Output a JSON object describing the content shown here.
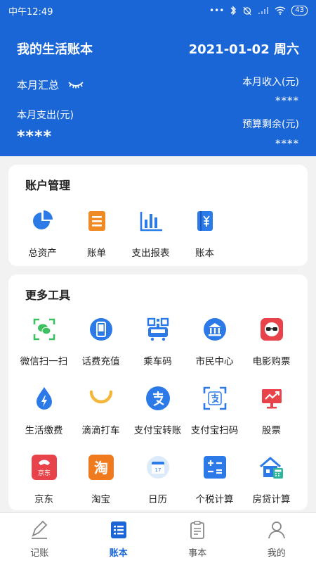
{
  "status_bar": {
    "time": "中午12:49",
    "dots": "•••",
    "battery": "43"
  },
  "header": {
    "title": "我的生活账本",
    "date": "2021-01-02 周六",
    "summary_label": "本月汇总",
    "spend_label": "本月支出(元)",
    "spend_value": "****",
    "income_label": "本月收入(元)",
    "income_value": "****",
    "budget_label": "预算剩余(元)",
    "budget_value": "****"
  },
  "accounts": {
    "title": "账户管理",
    "items": [
      {
        "label": "总资产",
        "icon": "pie-chart-icon"
      },
      {
        "label": "账单",
        "icon": "bill-list-icon"
      },
      {
        "label": "支出报表",
        "icon": "bar-chart-icon"
      },
      {
        "label": "账本",
        "icon": "ledger-book-icon"
      }
    ]
  },
  "tools": {
    "title": "更多工具",
    "items": [
      {
        "label": "微信扫一扫",
        "icon": "wechat-scan-icon"
      },
      {
        "label": "话费充值",
        "icon": "phone-recharge-icon"
      },
      {
        "label": "乘车码",
        "icon": "bus-code-icon"
      },
      {
        "label": "市民中心",
        "icon": "civic-center-icon"
      },
      {
        "label": "电影购票",
        "icon": "movie-ticket-icon"
      },
      {
        "label": "生活缴费",
        "icon": "utility-payment-icon"
      },
      {
        "label": "滴滴打车",
        "icon": "didi-icon"
      },
      {
        "label": "支付宝转账",
        "icon": "alipay-transfer-icon"
      },
      {
        "label": "支付宝扫码",
        "icon": "alipay-scan-icon"
      },
      {
        "label": "股票",
        "icon": "stock-icon"
      },
      {
        "label": "京东",
        "icon": "jd-icon",
        "badge": "京东"
      },
      {
        "label": "淘宝",
        "icon": "taobao-icon",
        "badge": "淘"
      },
      {
        "label": "日历",
        "icon": "calendar-icon",
        "badge": "17"
      },
      {
        "label": "个税计算",
        "icon": "tax-calculator-icon"
      },
      {
        "label": "房贷计算",
        "icon": "mortgage-calculator-icon"
      }
    ]
  },
  "tabbar": {
    "items": [
      {
        "label": "记账",
        "icon": "pen-icon",
        "active": false
      },
      {
        "label": "账本",
        "icon": "list-icon",
        "active": true
      },
      {
        "label": "事本",
        "icon": "clipboard-icon",
        "active": false
      },
      {
        "label": "我的",
        "icon": "user-icon",
        "active": false
      }
    ]
  },
  "colors": {
    "primary": "#1b66d6",
    "background": "#f2f2f2",
    "card": "#ffffff",
    "icon_blue": "#2b7ae8",
    "icon_orange": "#f08a24",
    "icon_red": "#e8424a",
    "icon_green": "#3cc060",
    "icon_yellow": "#f4b73c"
  }
}
